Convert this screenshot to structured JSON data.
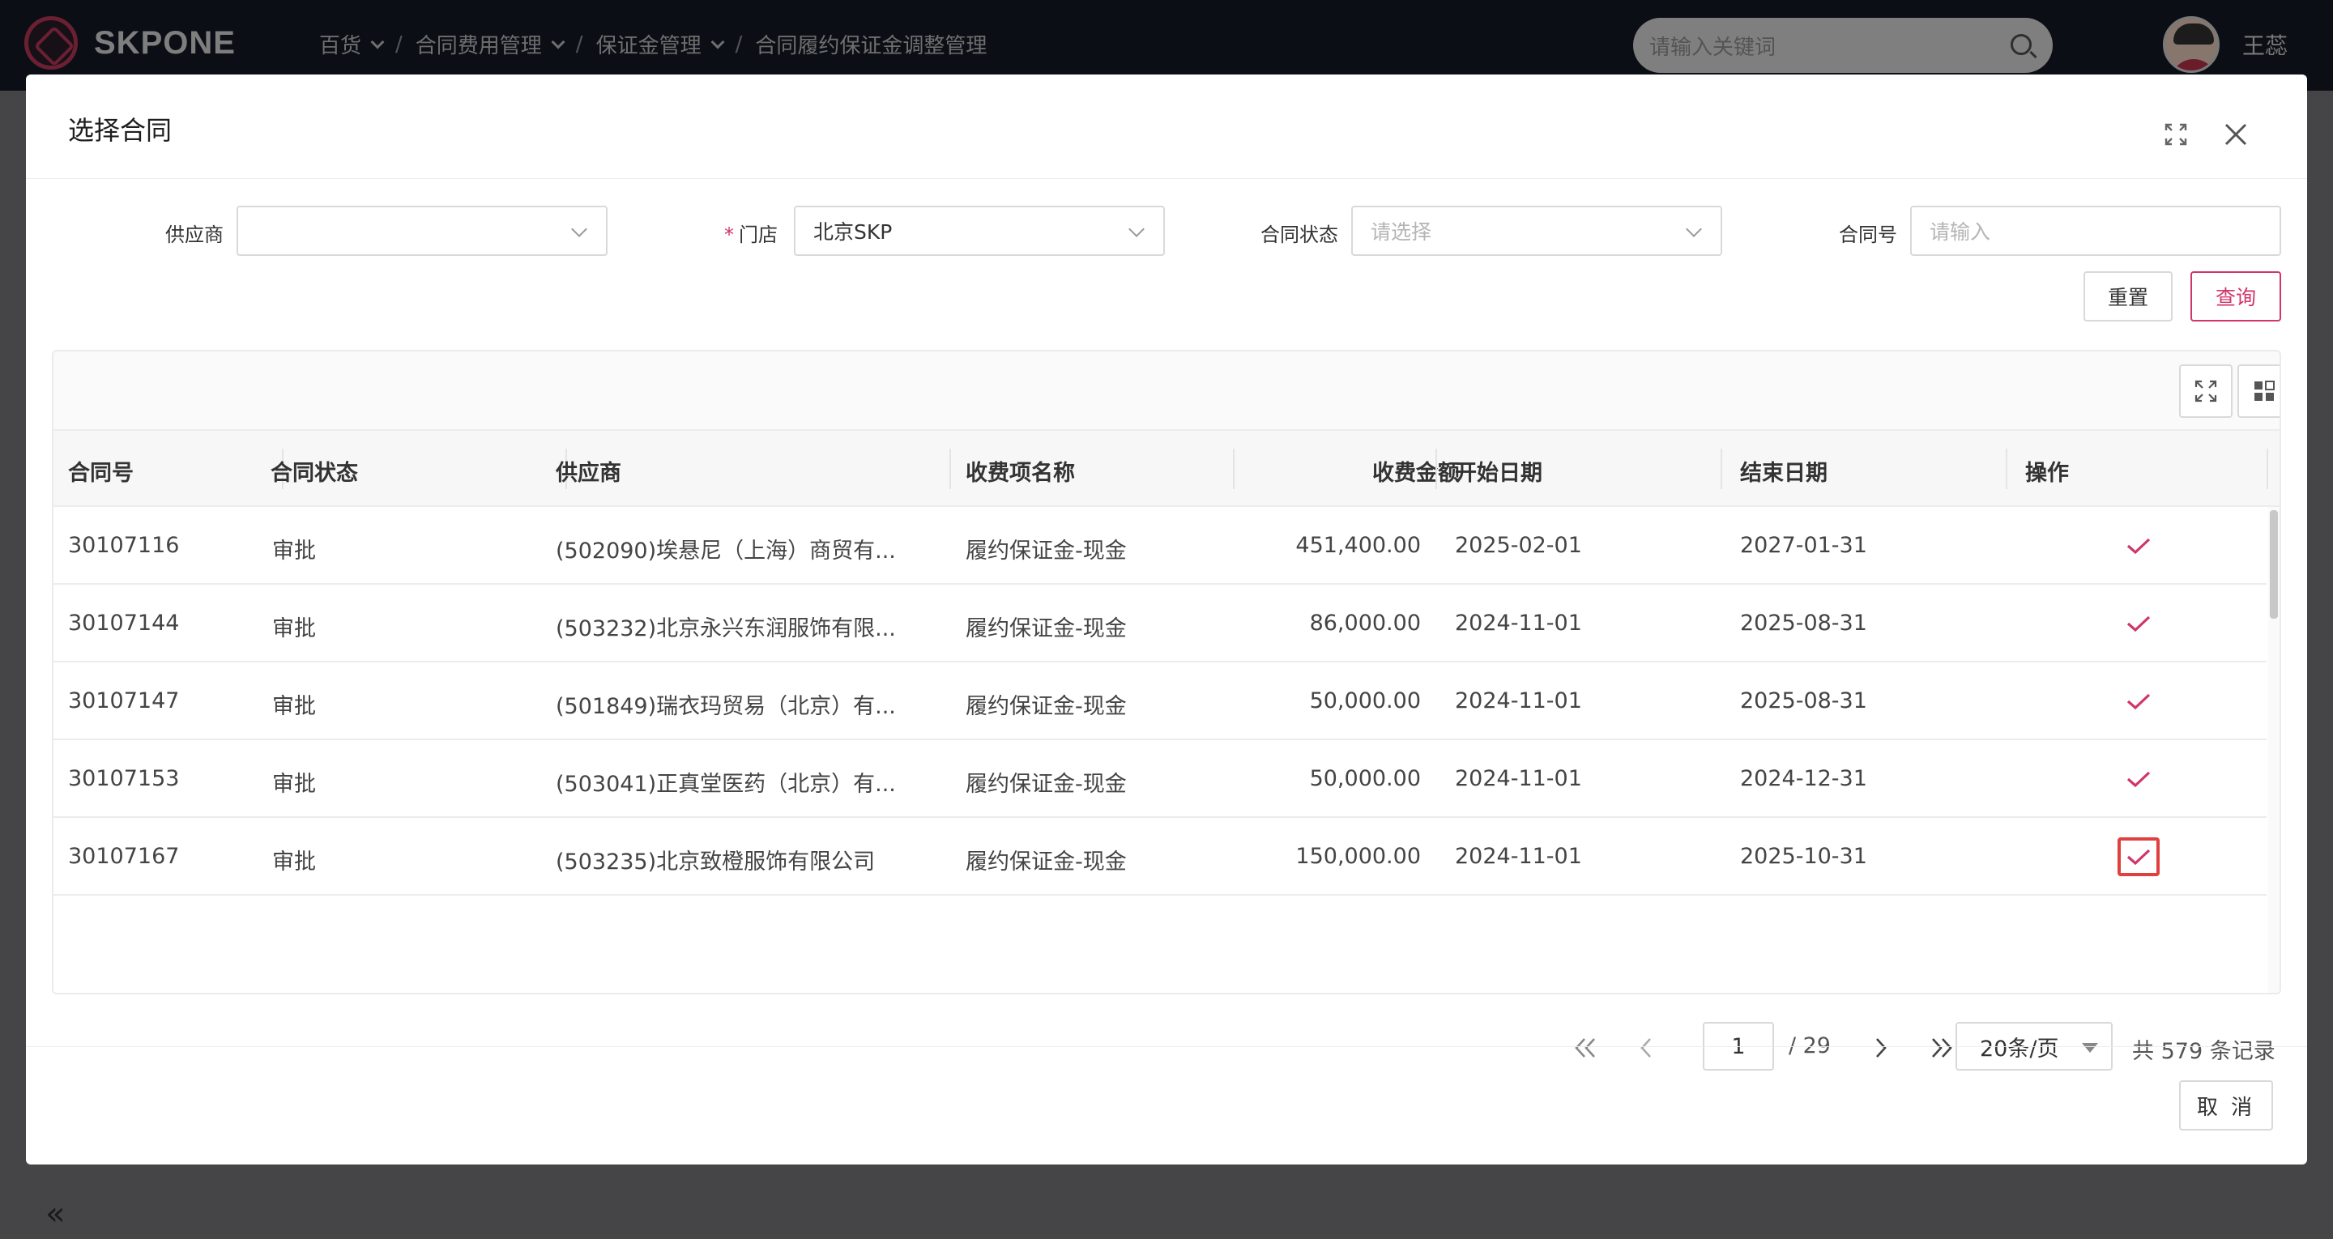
{
  "topbar": {
    "logo_text": "SKPONE",
    "breadcrumb": [
      "百货",
      "合同费用管理",
      "保证金管理",
      "合同履约保证金调整管理"
    ],
    "search_placeholder": "请输入关键词",
    "user_name": "王蕊"
  },
  "modal": {
    "title": "选择合同",
    "filters": {
      "supplier_label": "供应商",
      "supplier_value": "",
      "store_label": "门店",
      "store_value": "北京SKP",
      "status_label": "合同状态",
      "status_placeholder": "请选择",
      "contract_no_label": "合同号",
      "contract_no_placeholder": "请输入"
    },
    "buttons": {
      "reset": "重置",
      "query": "查询",
      "cancel": "取 消"
    },
    "table": {
      "headers": [
        "合同号",
        "合同状态",
        "供应商",
        "收费项名称",
        "收费金额",
        "开始日期",
        "结束日期",
        "操作"
      ],
      "rows": [
        [
          "30107116",
          "审批",
          "(502090)埃悬尼（上海）商贸有...",
          "履约保证金-现金",
          "451,400.00",
          "2025-02-01",
          "2027-01-31"
        ],
        [
          "30107144",
          "审批",
          "(503232)北京永兴东润服饰有限...",
          "履约保证金-现金",
          "86,000.00",
          "2024-11-01",
          "2025-08-31"
        ],
        [
          "30107147",
          "审批",
          "(501849)瑞衣玛贸易（北京）有...",
          "履约保证金-现金",
          "50,000.00",
          "2024-11-01",
          "2025-08-31"
        ],
        [
          "30107153",
          "审批",
          "(503041)正真堂医药（北京）有...",
          "履约保证金-现金",
          "50,000.00",
          "2024-11-01",
          "2024-12-31"
        ],
        [
          "30107167",
          "审批",
          "(503235)北京致橙服饰有限公司",
          "履约保证金-现金",
          "150,000.00",
          "2024-11-01",
          "2025-10-31"
        ]
      ]
    },
    "pagination": {
      "current_page": "1",
      "total_pages": "/ 29",
      "page_size": "20条/页",
      "total_records": "共 579 条记录"
    }
  },
  "colors": {
    "accent": "#d0356b",
    "focus_border": "#e04040"
  }
}
